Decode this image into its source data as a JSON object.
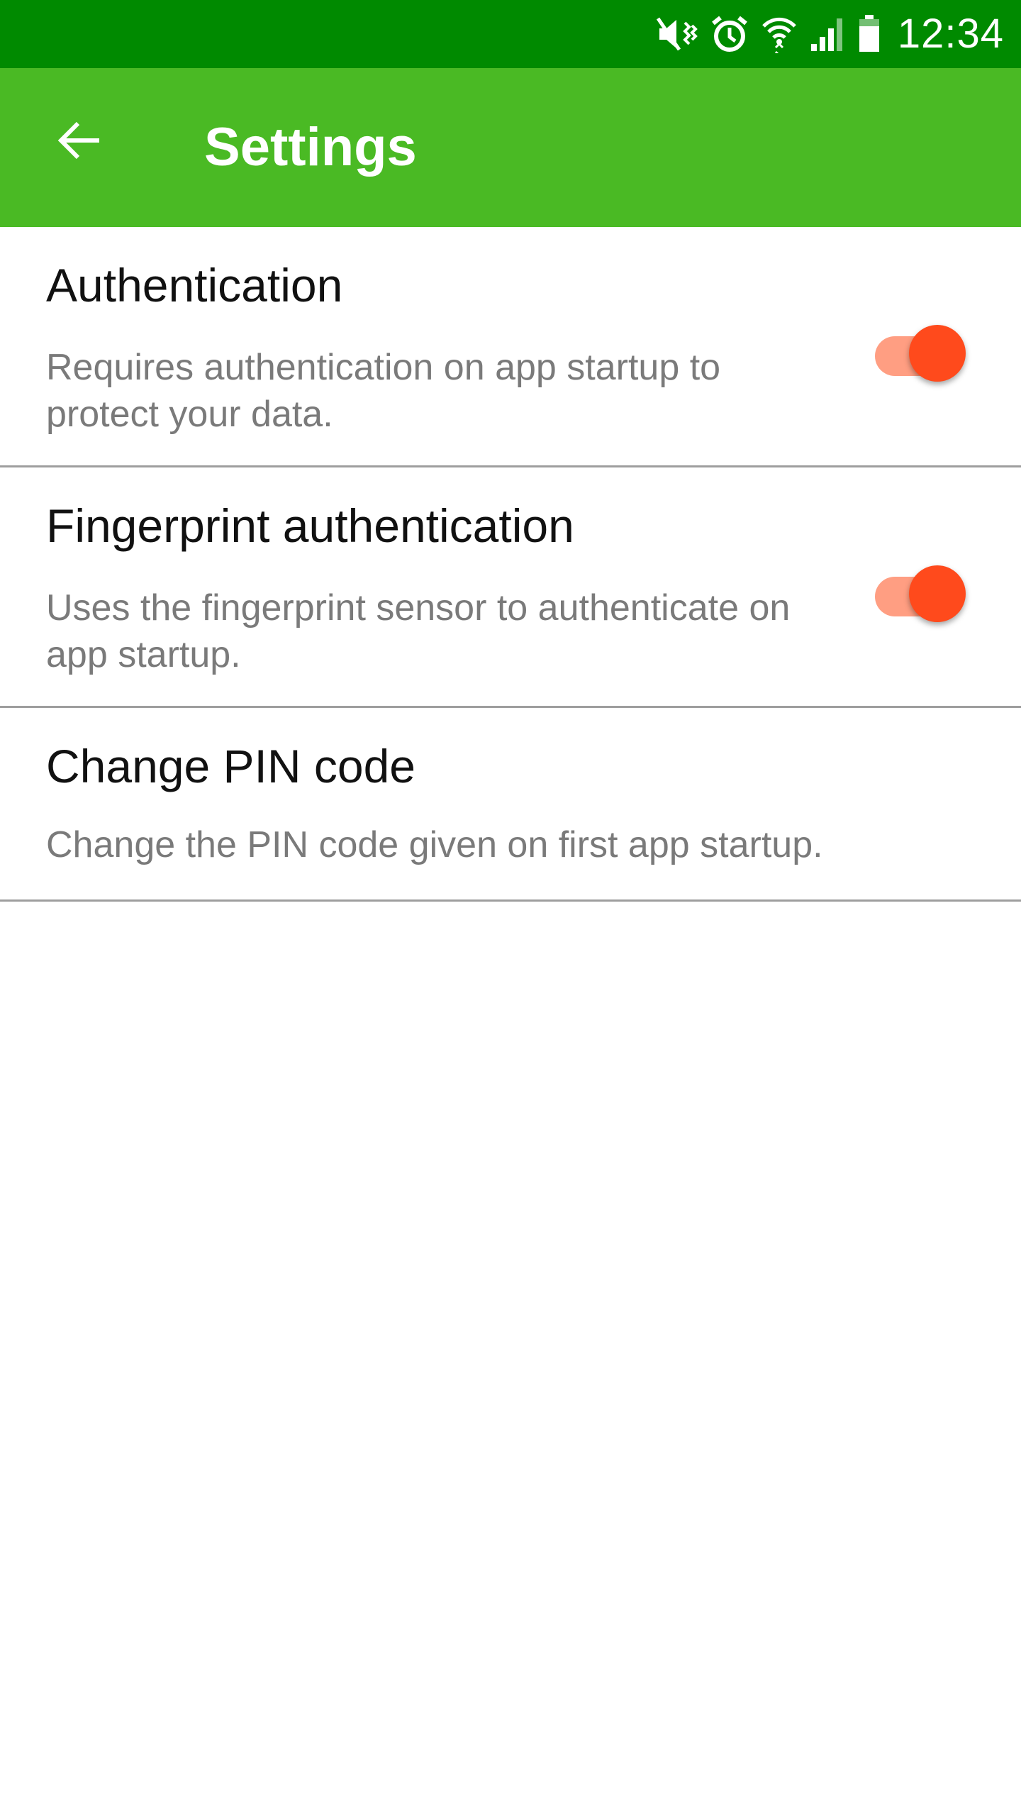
{
  "status_bar": {
    "time": "12:34",
    "icons": [
      "mute-vibrate-icon",
      "alarm-icon",
      "wifi-icon",
      "signal-icon",
      "battery-icon"
    ]
  },
  "app_bar": {
    "title": "Settings",
    "back_icon": "arrow-back-icon"
  },
  "settings": [
    {
      "title": "Authentication",
      "summary": "Requires authentication on app startup to protect your data.",
      "toggle_on": true
    },
    {
      "title": "Fingerprint authentication",
      "summary": "Uses the fingerprint sensor to authenticate on app startup.",
      "toggle_on": true
    },
    {
      "title": "Change PIN code",
      "summary": "Change the PIN code given on first app startup."
    }
  ],
  "colors": {
    "status_bar": "#008a00",
    "app_bar": "#4aba24",
    "accent": "#ff4a1c",
    "accent_track": "#ff9e82",
    "divider": "#9e9e9e",
    "summary_text": "#7a7a7a"
  }
}
